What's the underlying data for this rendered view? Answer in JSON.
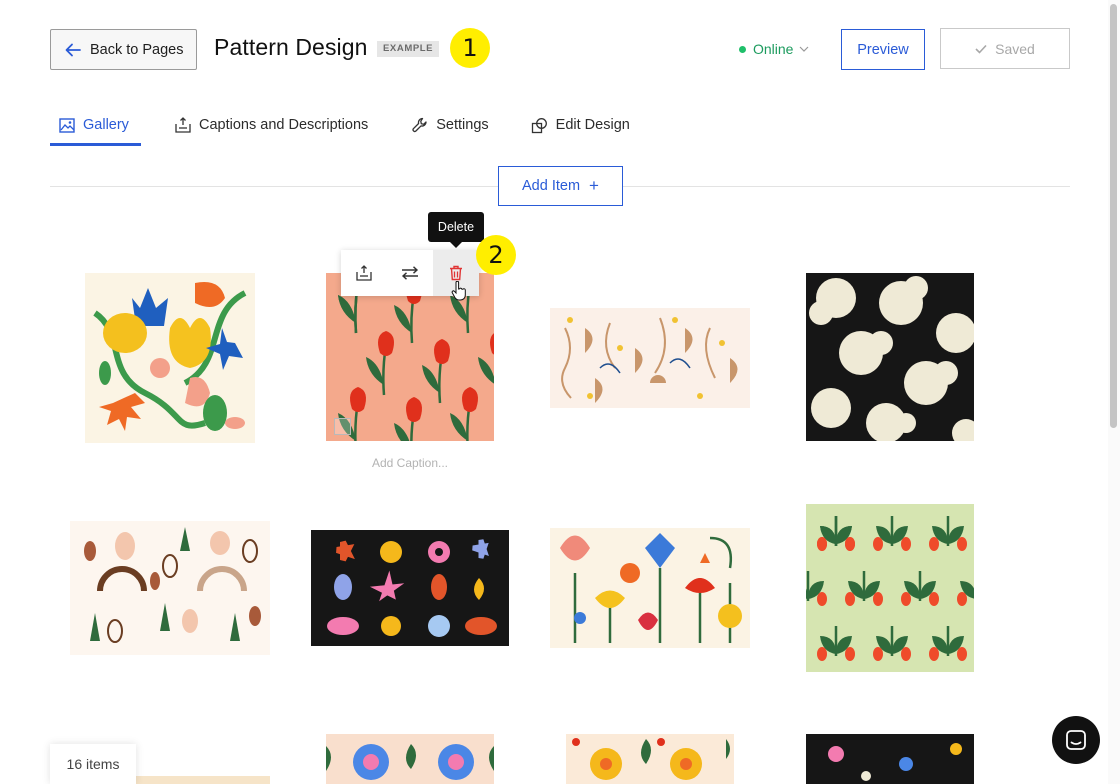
{
  "header": {
    "back_label": "Back to Pages",
    "title": "Pattern Design",
    "badge": "EXAMPLE",
    "status": "Online",
    "preview_label": "Preview",
    "saved_label": "Saved"
  },
  "markers": [
    "1",
    "2"
  ],
  "tabs": [
    {
      "label": "Gallery",
      "icon": "image-icon",
      "active": true
    },
    {
      "label": "Captions and Descriptions",
      "icon": "caption-icon",
      "active": false
    },
    {
      "label": "Settings",
      "icon": "wrench-icon",
      "active": false
    },
    {
      "label": "Edit Design",
      "icon": "design-icon",
      "active": false
    }
  ],
  "add_item_label": "Add Item",
  "tooltip": "Delete",
  "item_toolbar": [
    {
      "name": "caption-icon"
    },
    {
      "name": "replace-icon"
    },
    {
      "name": "trash-icon"
    }
  ],
  "caption_placeholder": "Add Caption...",
  "items_count": "16 items",
  "colors": {
    "accent": "#2a5bd7",
    "online": "#1fbf6a",
    "marker": "#ffee00",
    "delete": "#e03535"
  }
}
